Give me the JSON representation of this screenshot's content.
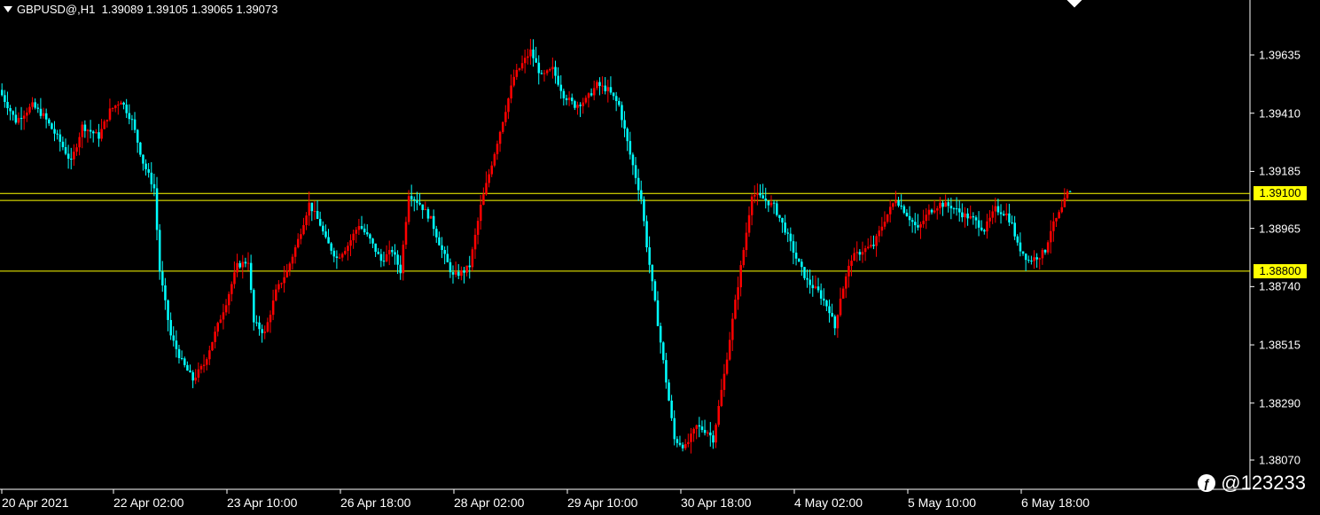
{
  "header": {
    "symbol": "GBPUSD@,H1",
    "ohlc": "1.39089 1.39105 1.39065 1.39073"
  },
  "watermark": {
    "text": "@123233",
    "icon": "brand-logo-icon"
  },
  "colors": {
    "background": "#000000",
    "bull": "#ff0000",
    "bear": "#00ffff",
    "line": "#ffff00",
    "axis": "#ffffff"
  },
  "chart_data": {
    "type": "candlestick",
    "symbol": "GBPUSD@",
    "timeframe": "H1",
    "y_ticks": [
      "1.39635",
      "1.39410",
      "1.39185",
      "1.38965",
      "1.38740",
      "1.38515",
      "1.38290",
      "1.38070"
    ],
    "x_ticks": [
      "20 Apr 2021",
      "22 Apr 02:00",
      "23 Apr 10:00",
      "26 Apr 18:00",
      "28 Apr 02:00",
      "29 Apr 10:00",
      "30 Apr 18:00",
      "4 May 02:00",
      "5 May 10:00",
      "6 May 18:00"
    ],
    "ylim": [
      1.38,
      1.398
    ],
    "horizontal_lines": [
      {
        "price": 1.391,
        "label": "1.39100"
      },
      {
        "price": 1.39073,
        "label": ""
      },
      {
        "price": 1.388,
        "label": "1.38800"
      }
    ],
    "price_path": [
      [
        0,
        1.395
      ],
      [
        6,
        1.3938
      ],
      [
        12,
        1.3944
      ],
      [
        16,
        1.394
      ],
      [
        22,
        1.393
      ],
      [
        26,
        1.3922
      ],
      [
        30,
        1.3936
      ],
      [
        36,
        1.3932
      ],
      [
        40,
        1.3942
      ],
      [
        44,
        1.3946
      ],
      [
        48,
        1.3938
      ],
      [
        52,
        1.3922
      ],
      [
        56,
        1.3912
      ],
      [
        58,
        1.388
      ],
      [
        62,
        1.3855
      ],
      [
        66,
        1.3845
      ],
      [
        70,
        1.3838
      ],
      [
        74,
        1.3844
      ],
      [
        78,
        1.3856
      ],
      [
        82,
        1.3868
      ],
      [
        86,
        1.3882
      ],
      [
        90,
        1.3884
      ],
      [
        92,
        1.386
      ],
      [
        96,
        1.3856
      ],
      [
        100,
        1.3872
      ],
      [
        104,
        1.388
      ],
      [
        108,
        1.3892
      ],
      [
        112,
        1.3906
      ],
      [
        116,
        1.3898
      ],
      [
        118,
        1.3892
      ],
      [
        122,
        1.3885
      ],
      [
        126,
        1.389
      ],
      [
        130,
        1.3898
      ],
      [
        134,
        1.3892
      ],
      [
        138,
        1.3884
      ],
      [
        142,
        1.3888
      ],
      [
        145,
        1.388
      ],
      [
        148,
        1.391
      ],
      [
        152,
        1.3906
      ],
      [
        156,
        1.39
      ],
      [
        160,
        1.3888
      ],
      [
        164,
        1.3878
      ],
      [
        168,
        1.388
      ],
      [
        170,
        1.3882
      ],
      [
        174,
        1.3905
      ],
      [
        180,
        1.393
      ],
      [
        186,
        1.3955
      ],
      [
        192,
        1.3965
      ],
      [
        196,
        1.3955
      ],
      [
        200,
        1.3958
      ],
      [
        204,
        1.3948
      ],
      [
        208,
        1.3944
      ],
      [
        212,
        1.3946
      ],
      [
        216,
        1.3952
      ],
      [
        220,
        1.395
      ],
      [
        224,
        1.3944
      ],
      [
        228,
        1.3925
      ],
      [
        232,
        1.3908
      ],
      [
        234,
        1.389
      ],
      [
        238,
        1.386
      ],
      [
        242,
        1.383
      ],
      [
        244,
        1.3815
      ],
      [
        248,
        1.3812
      ],
      [
        252,
        1.382
      ],
      [
        256,
        1.3818
      ],
      [
        258,
        1.3815
      ],
      [
        262,
        1.384
      ],
      [
        266,
        1.3868
      ],
      [
        270,
        1.3895
      ],
      [
        272,
        1.391
      ],
      [
        276,
        1.3908
      ],
      [
        280,
        1.3905
      ],
      [
        284,
        1.3896
      ],
      [
        288,
        1.3885
      ],
      [
        292,
        1.3876
      ],
      [
        296,
        1.3872
      ],
      [
        300,
        1.3865
      ],
      [
        302,
        1.3858
      ],
      [
        304,
        1.387
      ],
      [
        308,
        1.3885
      ],
      [
        312,
        1.3888
      ],
      [
        316,
        1.389
      ],
      [
        320,
        1.39
      ],
      [
        324,
        1.3908
      ],
      [
        328,
        1.3902
      ],
      [
        332,
        1.3896
      ],
      [
        336,
        1.3903
      ],
      [
        340,
        1.3906
      ],
      [
        344,
        1.3905
      ],
      [
        348,
        1.3902
      ],
      [
        352,
        1.39
      ],
      [
        356,
        1.3896
      ],
      [
        360,
        1.3904
      ],
      [
        364,
        1.3902
      ],
      [
        366,
        1.3898
      ],
      [
        368,
        1.389
      ],
      [
        372,
        1.3884
      ],
      [
        376,
        1.3886
      ],
      [
        378,
        1.3888
      ],
      [
        380,
        1.3896
      ],
      [
        384,
        1.3904
      ],
      [
        386,
        1.391
      ]
    ]
  }
}
